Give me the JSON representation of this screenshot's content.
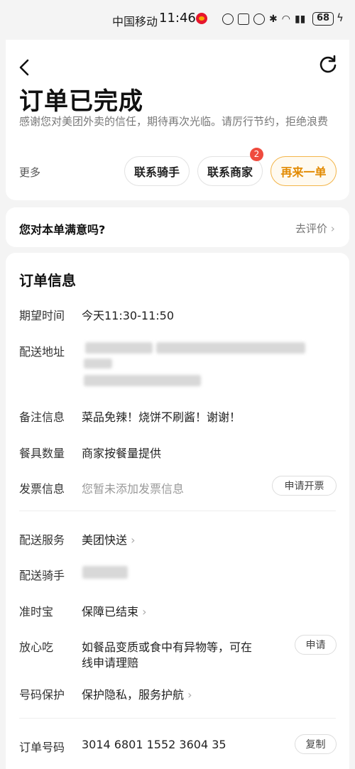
{
  "status_bar": {
    "carrier": "中国移动",
    "time": "11:46",
    "battery": "68"
  },
  "header": {
    "title": "订单已完成",
    "subtitle": "感谢您对美团外卖的信任，期待再次光临。请厉行节约，拒绝浪费",
    "more_label": "更多",
    "contact_rider": "联系骑手",
    "contact_merchant": "联系商家",
    "merchant_badge": "2",
    "reorder": "再来一单"
  },
  "satisfaction": {
    "question": "您对本单满意吗?",
    "link": "去评价"
  },
  "order_info": {
    "title": "订单信息",
    "rows": {
      "expected_time": {
        "label": "期望时间",
        "value": "今天11:30-11:50"
      },
      "address": {
        "label": "配送地址"
      },
      "remarks": {
        "label": "备注信息",
        "value": "菜品免辣！烧饼不刷酱！谢谢！"
      },
      "utensils": {
        "label": "餐具数量",
        "value": "商家按餐量提供"
      },
      "invoice": {
        "label": "发票信息",
        "value": "您暂未添加发票信息",
        "button": "申请开票"
      },
      "delivery_service": {
        "label": "配送服务",
        "value": "美团快送"
      },
      "rider": {
        "label": "配送骑手"
      },
      "on_time": {
        "label": "准时宝",
        "value": "保障已结束"
      },
      "safe_eat": {
        "label": "放心吃",
        "value_line1": "如餐品变质或食中有异物等，可在",
        "value_line2": "线申请理赔",
        "button": "申请"
      },
      "number_protection": {
        "label": "号码保护",
        "value": "保护隐私，服务护航"
      },
      "order_number": {
        "label": "订单号码",
        "value": "3014 6801 1552 3604 35",
        "button": "复制"
      }
    }
  },
  "colors": {
    "accent": "#e28a00",
    "badge": "#ef4b3e",
    "background": "#f4f4f4"
  }
}
